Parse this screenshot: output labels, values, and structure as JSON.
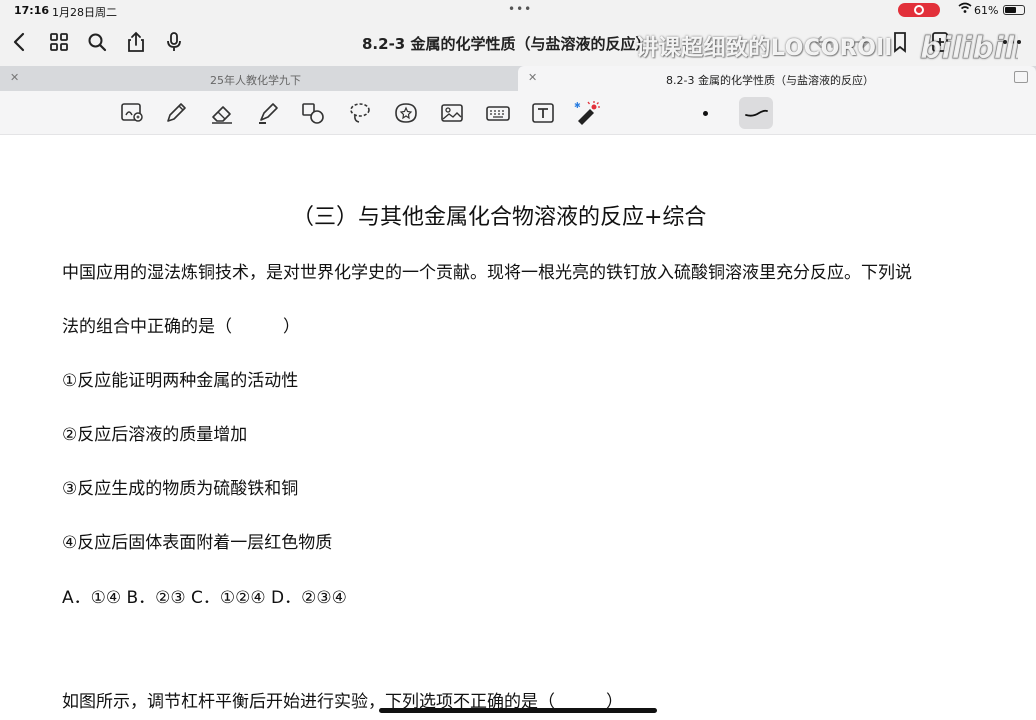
{
  "status_bar": {
    "time": "17:16",
    "date": "1月28日周二",
    "battery_text": "61%",
    "battery_level": 0.61,
    "record_color": "#e2303a"
  },
  "nav_bar": {
    "title": "8.2-3 金属的化学性质（与盐溶液的反应）",
    "icons_left": [
      "back-icon",
      "grid-icon",
      "search-icon",
      "share-icon",
      "microphone-icon"
    ],
    "icons_right": [
      "undo-icon",
      "redo-icon",
      "bookmark-icon",
      "add-page-icon",
      "more-icon"
    ]
  },
  "watermark": {
    "text": "讲课超细致的LOCOROll",
    "logo": "bilibili"
  },
  "tabs": [
    {
      "label": "25年人教化学九下",
      "active": false
    },
    {
      "label": "8.2-3 金属的化学性质（与盐溶液的反应）",
      "active": true
    }
  ],
  "toolbar": {
    "tools": [
      "zoom-write-icon",
      "pen-icon",
      "eraser-icon",
      "highlighter-icon",
      "shapes-icon",
      "lasso-icon",
      "sticker-icon",
      "image-icon",
      "keyboard-icon",
      "text-icon",
      "laser-pointer-icon"
    ],
    "pen_sizes": [
      "dot",
      "stroke"
    ],
    "accent": "#e2303a"
  },
  "document": {
    "title": "（三）与其他金属化合物溶液的反应+综合",
    "lines": [
      "中国应用的湿法炼铜技术，是对世界化学史的一个贡献。现将一根光亮的铁钉放入硫酸铜溶液里充分反应。下列说",
      "法的组合中正确的是（　　　）",
      "①反应能证明两种金属的活动性",
      "②反应后溶液的质量增加",
      "③反应生成的物质为硫酸铁和铜",
      "④反应后固体表面附着一层红色物质",
      "A．①④  B．②③  C．①②④     D．②③④",
      "如图所示，调节杠杆平衡后开始进行实验，下列选项不正确的是（　　　）"
    ]
  }
}
